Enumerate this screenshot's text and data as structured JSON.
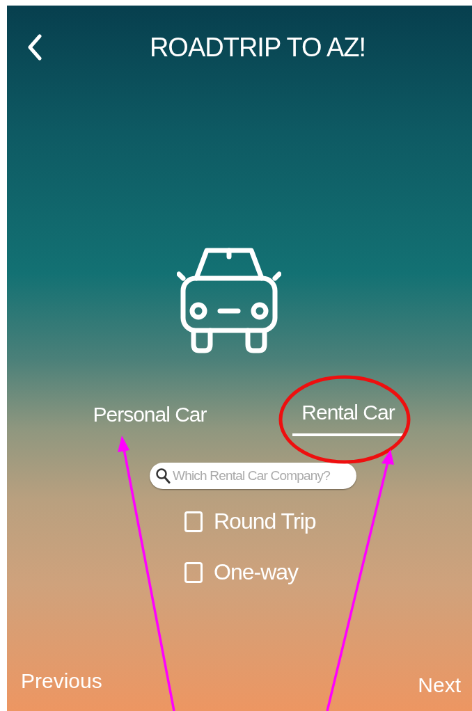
{
  "header": {
    "title": "ROADTRIP TO AZ!"
  },
  "tabs": [
    {
      "label": "Personal Car",
      "selected": false
    },
    {
      "label": "Rental Car",
      "selected": true
    }
  ],
  "search": {
    "placeholder": "Which Rental Car Company?"
  },
  "options": [
    {
      "label": "Round Trip",
      "checked": false
    },
    {
      "label": "One-way",
      "checked": false
    }
  ],
  "footer": {
    "previous": "Previous",
    "next": "Next"
  }
}
